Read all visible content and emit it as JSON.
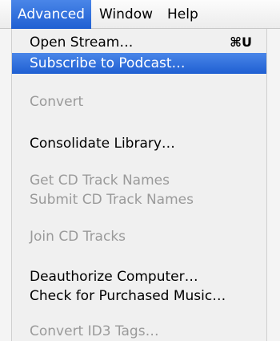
{
  "menubar": {
    "items": [
      "Advanced",
      "Window",
      "Help"
    ]
  },
  "menu": {
    "open_stream": {
      "label": "Open Stream…",
      "shortcut": "⌘U"
    },
    "subscribe_podcast": {
      "label": "Subscribe to Podcast…"
    },
    "convert": {
      "label": "Convert"
    },
    "consolidate_library": {
      "label": "Consolidate Library…"
    },
    "get_cd_track_names": {
      "label": "Get CD Track Names"
    },
    "submit_cd_track_names": {
      "label": "Submit CD Track Names"
    },
    "join_cd_tracks": {
      "label": "Join CD Tracks"
    },
    "deauthorize_computer": {
      "label": "Deauthorize Computer…"
    },
    "check_purchased_music": {
      "label": "Check for Purchased Music…"
    },
    "convert_id3_tags": {
      "label": "Convert ID3 Tags…"
    }
  },
  "colors": {
    "highlight": "#2a6be0",
    "disabled_text": "#9a9a9a"
  }
}
